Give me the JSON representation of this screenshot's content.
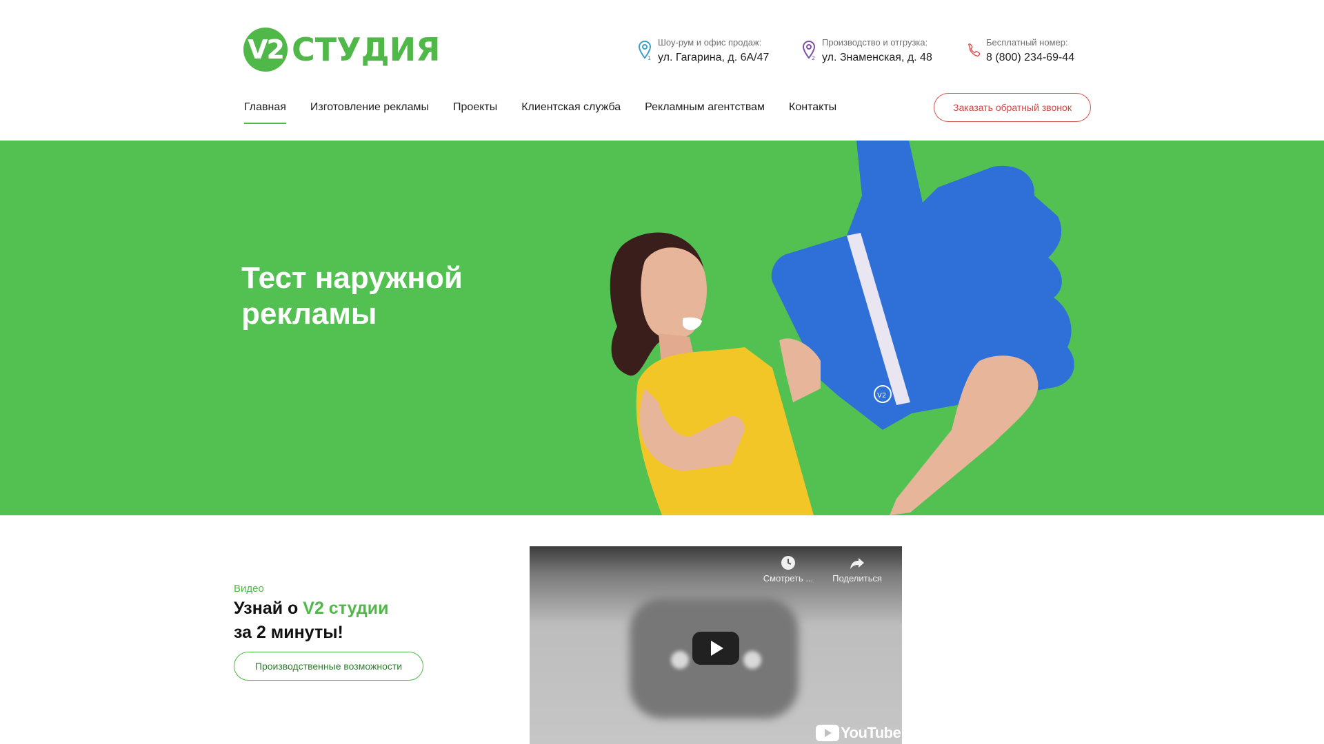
{
  "brand": {
    "logo_mark": "V2",
    "logo_text": "СТУДИЯ",
    "accent_color": "#4fb848",
    "alert_color": "#d4463f"
  },
  "header": {
    "contacts": [
      {
        "label": "Шоу-рум и офис продаж:",
        "value": "ул. Гагарина, д. 6А/47",
        "icon": "map-pin-1-icon"
      },
      {
        "label": "Производство и отгрузка:",
        "value": "ул. Знаменская, д. 48",
        "icon": "map-pin-2-icon"
      },
      {
        "label": "Бесплатный номер:",
        "value": "8 (800) 234-69-44",
        "icon": "phone-icon"
      }
    ],
    "nav": [
      {
        "label": "Главная",
        "active": true
      },
      {
        "label": "Изготовление рекламы"
      },
      {
        "label": "Проекты"
      },
      {
        "label": "Клиентская служба"
      },
      {
        "label": "Рекламным агентствам"
      },
      {
        "label": "Контакты"
      }
    ],
    "callback_label": "Заказать обратный звонок"
  },
  "hero": {
    "title": "Тест наружной рекламы",
    "background_color": "#52c152",
    "card_logo": "V2"
  },
  "video_section": {
    "label": "Видео",
    "heading_part1": "Узнай о ",
    "heading_highlight": "V2 студии",
    "heading_part2": "за 2 минуты!",
    "button_label": "Производственные возможности",
    "player": {
      "watch_later_label": "Смотреть ...",
      "share_label": "Поделиться",
      "logo_text": "YouTube"
    }
  }
}
